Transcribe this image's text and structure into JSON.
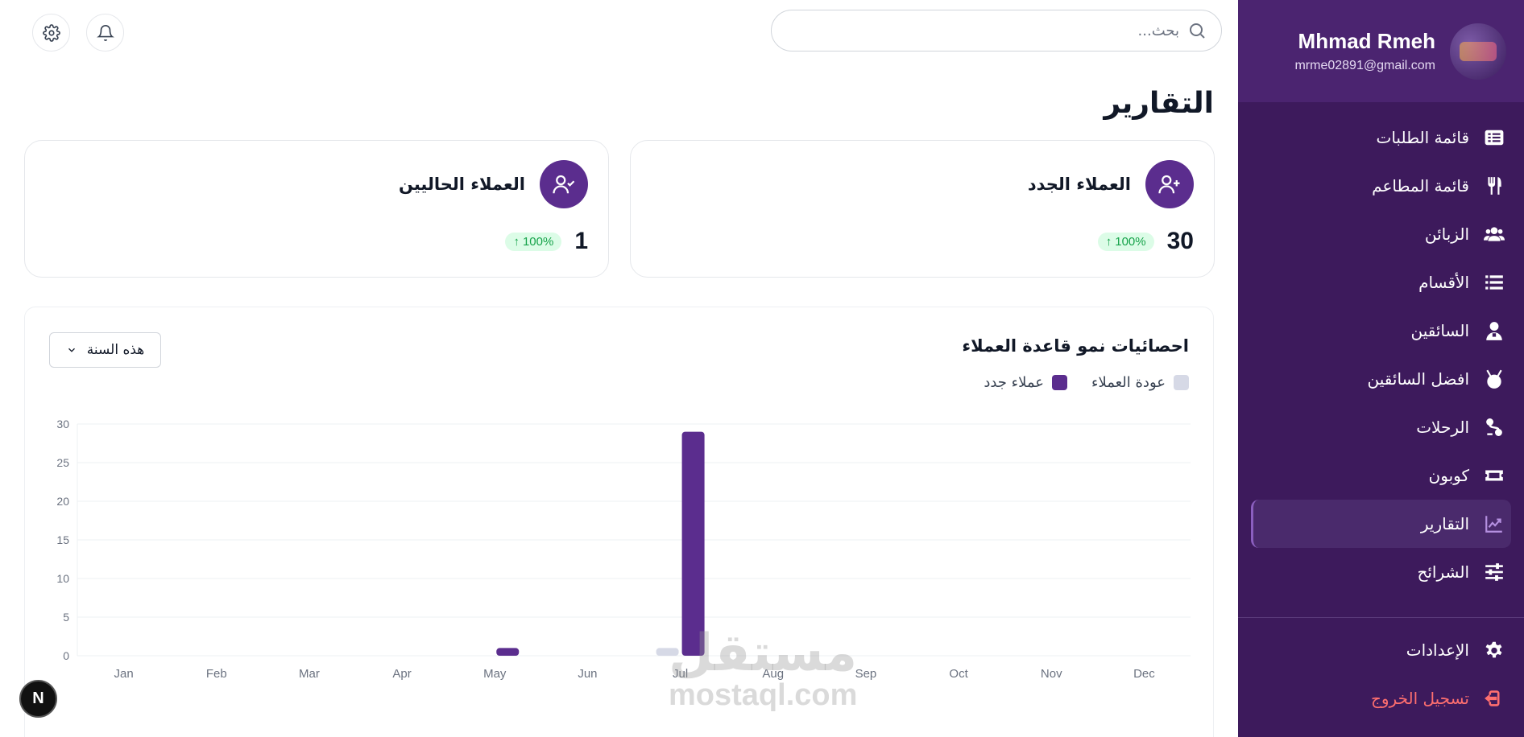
{
  "user": {
    "name": "Mhmad Rmeh",
    "email": "mrme02891@gmail.com",
    "avatar_icon": "restaurant-logo-avatar"
  },
  "search": {
    "placeholder": "بحث..."
  },
  "top_icons": [
    "gear-icon",
    "bell-icon"
  ],
  "page": {
    "title": "التقارير"
  },
  "sidebar": {
    "items": [
      {
        "label": "قائمة الطلبات",
        "icon": "order-list-icon"
      },
      {
        "label": "قائمة المطاعم",
        "icon": "utensils-icon"
      },
      {
        "label": "الزبائن",
        "icon": "users-icon"
      },
      {
        "label": "الأقسام",
        "icon": "list-icon"
      },
      {
        "label": "السائقين",
        "icon": "driver-icon"
      },
      {
        "label": "افضل السائقين",
        "icon": "medal-icon"
      },
      {
        "label": "الرحلات",
        "icon": "route-icon"
      },
      {
        "label": "كوبون",
        "icon": "ticket-icon"
      },
      {
        "label": "التقارير",
        "icon": "chart-line-icon",
        "active": true
      },
      {
        "label": "الشرائح",
        "icon": "sliders-icon"
      }
    ],
    "settings_label": "الإعدادات",
    "logout_label": "تسجيل الخروج"
  },
  "cards": {
    "new_customers": {
      "title": "العملاء الجدد",
      "value": "30",
      "change": "100%"
    },
    "current_customers": {
      "title": "العملاء الحاليين",
      "value": "1",
      "change": "100%"
    }
  },
  "chart": {
    "title": "احصائيات نمو قاعدة العملاء",
    "period": "هذه السنة",
    "legend": {
      "returning": "عودة العملاء",
      "new": "عملاء جدد"
    }
  },
  "colors": {
    "sidebar": "#3d1a5c",
    "primary": "#5b2d8e",
    "returning": "#d6d9e6",
    "success": "#16a34a",
    "danger": "#ff6f6f"
  },
  "chart_data": {
    "type": "bar",
    "title": "احصائيات نمو قاعدة العملاء",
    "categories": [
      "Jan",
      "Feb",
      "Mar",
      "Apr",
      "May",
      "Jun",
      "Jul",
      "Aug",
      "Sep",
      "Oct",
      "Nov",
      "Dec"
    ],
    "series": [
      {
        "name": "عودة العملاء",
        "values": [
          0,
          0,
          0,
          0,
          0,
          0,
          1,
          0,
          0,
          0,
          0,
          0
        ]
      },
      {
        "name": "عملاء جدد",
        "values": [
          0,
          0,
          0,
          0,
          1,
          0,
          29,
          0,
          0,
          0,
          0,
          0
        ]
      }
    ],
    "yticks": [
      0,
      5,
      10,
      15,
      20,
      25,
      30
    ],
    "ylim": [
      0,
      30
    ],
    "grid": true,
    "legend_position": "top-right"
  },
  "misc": {
    "fab_label": "N",
    "watermark_ar": "مستقل",
    "watermark_en": "mostaql.com"
  }
}
